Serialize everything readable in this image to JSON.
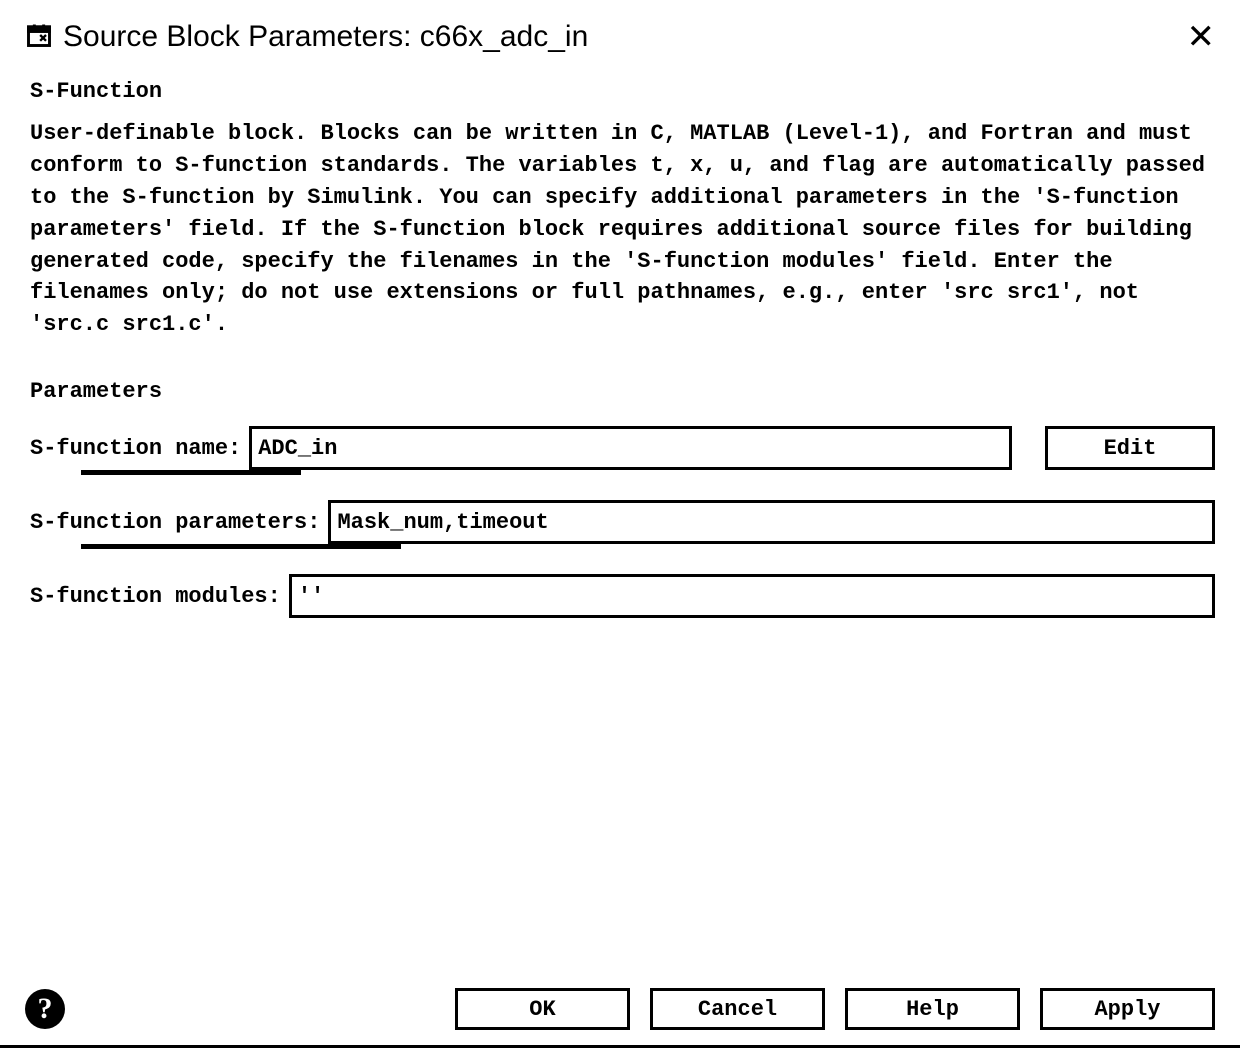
{
  "window": {
    "title": "Source Block Parameters: c66x_adc_in"
  },
  "section": {
    "sfunction_label": "S-Function",
    "description": "User-definable block.  Blocks can be written in C, MATLAB (Level-1), and Fortran and must conform to S-function standards.  The variables t, x, u, and flag are automatically passed to the S-function by Simulink. You can specify additional parameters in the 'S-function parameters' field. If the S-function block requires additional source files for building generated code, specify the filenames in the 'S-function modules' field. Enter the filenames only; do not use extensions or full pathnames, e.g., enter 'src src1', not 'src.c src1.c'.",
    "parameters_label": "Parameters"
  },
  "fields": {
    "name_label": "S-function name:",
    "name_value": "ADC_in",
    "edit_label": "Edit",
    "params_label": "S-function parameters:",
    "params_value": "Mask_num,timeout",
    "modules_label": "S-function modules:",
    "modules_value": "''"
  },
  "buttons": {
    "ok": "OK",
    "cancel": "Cancel",
    "help": "Help",
    "apply": "Apply"
  }
}
